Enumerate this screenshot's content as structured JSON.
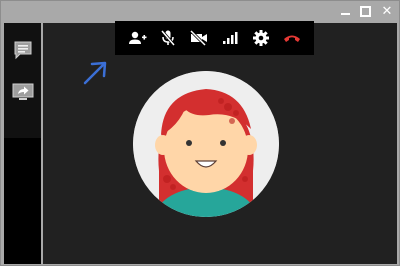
{
  "window": {
    "controls": {
      "minimize": "minimize-icon",
      "maximize": "maximize-icon",
      "close": "close-icon"
    },
    "close_glyph": "✕"
  },
  "sidebar": {
    "items": [
      {
        "icon": "chat-icon"
      },
      {
        "icon": "screen-share-icon"
      }
    ]
  },
  "toolbar": {
    "buttons": [
      {
        "icon": "add-person-icon"
      },
      {
        "icon": "mic-off-icon"
      },
      {
        "icon": "video-off-icon"
      },
      {
        "icon": "signal-bars-icon"
      },
      {
        "icon": "settings-gear-icon"
      },
      {
        "icon": "hang-up-icon"
      }
    ],
    "hangup_color": "#e53935"
  },
  "annotation": {
    "icon": "pointer-arrow-icon",
    "color": "#3b6fd6"
  },
  "participant": {
    "avatar_icon": "red-haired-woman-avatar"
  },
  "colors": {
    "titlebar": "#a9a9a9",
    "sidebar": "#000000",
    "video_background": "#212121",
    "toolbar": "#000000"
  }
}
